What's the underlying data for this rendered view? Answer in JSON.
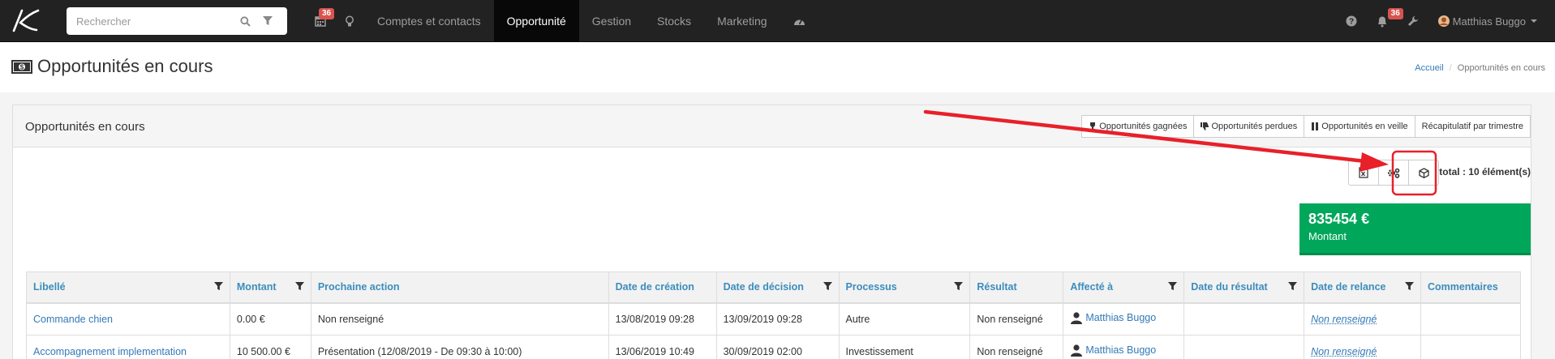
{
  "topbar": {
    "search_placeholder": "Rechercher",
    "calendar_badge": "36",
    "notifications_badge": "36",
    "menu": [
      "Comptes et contacts",
      "Opportunité",
      "Gestion",
      "Stocks",
      "Marketing"
    ],
    "active_menu": "Opportunité",
    "user_name": "Matthias Buggo"
  },
  "page": {
    "title": "Opportunités en cours",
    "breadcrumb": {
      "home": "Accueil",
      "current": "Opportunités en cours"
    }
  },
  "panel": {
    "title": "Opportunités en cours",
    "tabs": [
      "Opportunités gagnées",
      "Opportunités perdues",
      "Opportunités en veille",
      "Récapitulatif par trimestre"
    ],
    "total": "total : 10 élément(s)",
    "kpi": {
      "value": "835454 €",
      "label": "Montant",
      "color": "#00a65a"
    }
  },
  "table": {
    "headers": [
      "Libellé",
      "Montant",
      "Prochaine action",
      "Date de création",
      "Date de décision",
      "Processus",
      "Résultat",
      "Affecté à",
      "Date du résultat",
      "Date de relance",
      "Commentaires"
    ],
    "rows": [
      [
        "Commande chien",
        "0.00 €",
        "Non renseigné",
        "13/08/2019 09:28",
        "13/09/2019 09:28",
        "Autre",
        "Non renseigné",
        "Matthias Buggo",
        "",
        "Non renseigné",
        ""
      ],
      [
        "Accompagnement implementation",
        "10 500.00 €",
        "Présentation (12/08/2019 - De 09:30 à 10:00)",
        "13/06/2019 10:49",
        "30/09/2019 02:00",
        "Investissement",
        "Non renseigné",
        "Matthias Buggo",
        "",
        "Non renseigné",
        ""
      ]
    ]
  },
  "colors": {
    "navbar": "#222222",
    "link": "#3c8dbc",
    "annotation": "#e8202a"
  }
}
